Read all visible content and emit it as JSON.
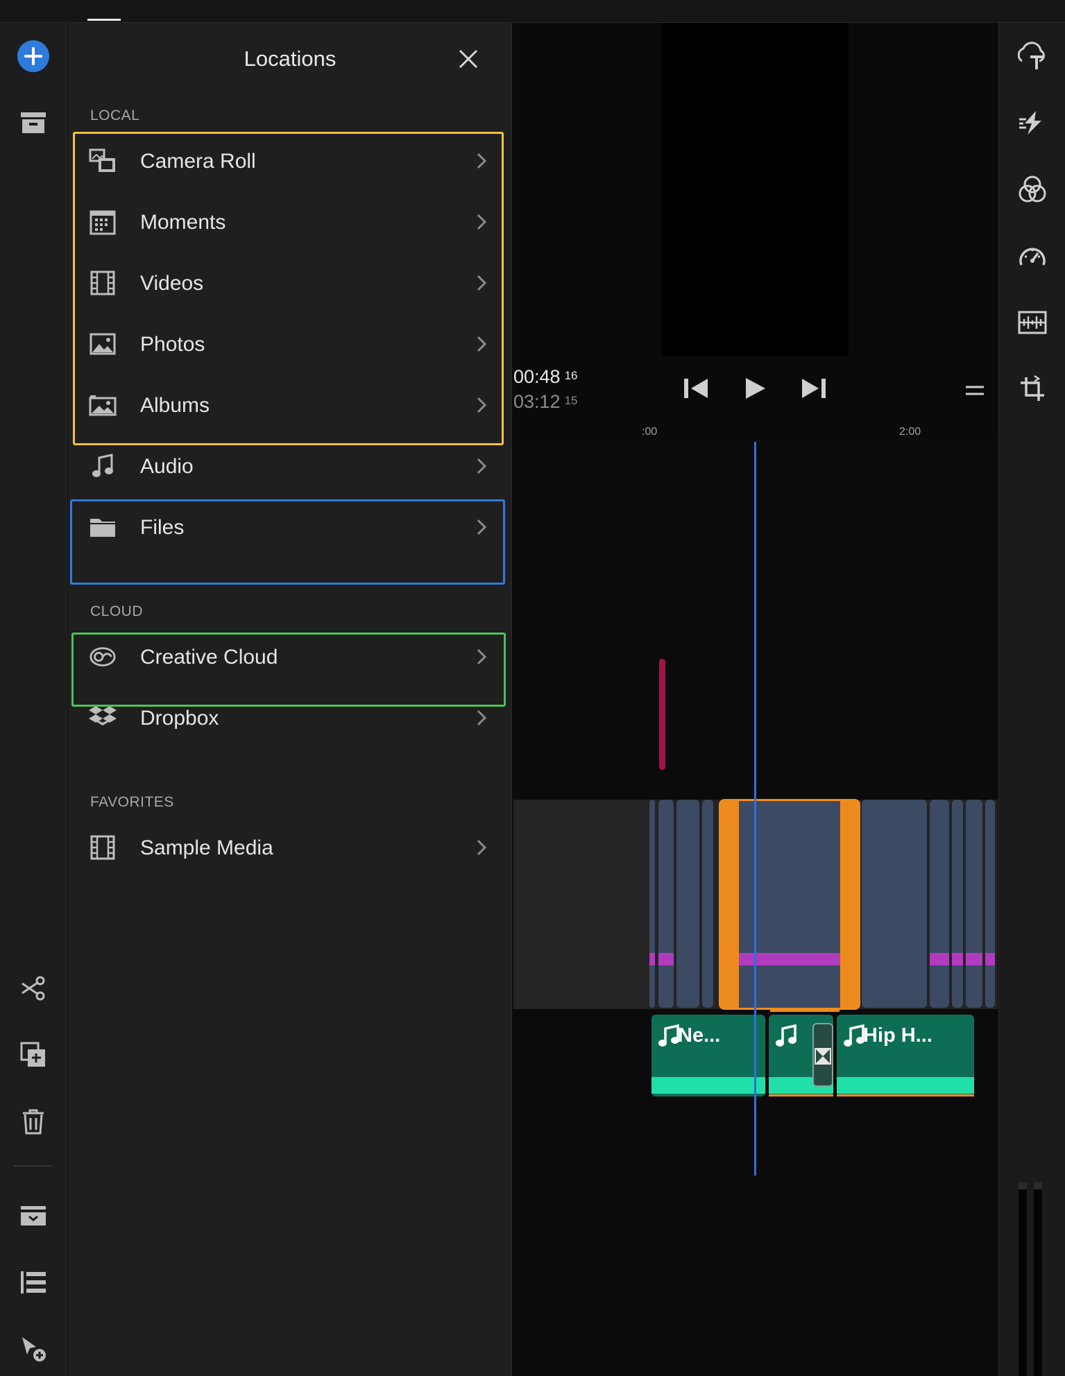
{
  "panel": {
    "title": "Locations",
    "sections": {
      "local": "LOCAL",
      "cloud": "CLOUD",
      "favorites": "FAVORITES"
    },
    "local_items": [
      {
        "label": "Camera Roll",
        "icon": "camera-roll-icon"
      },
      {
        "label": "Moments",
        "icon": "calendar-icon"
      },
      {
        "label": "Videos",
        "icon": "film-icon"
      },
      {
        "label": "Photos",
        "icon": "photo-icon"
      },
      {
        "label": "Albums",
        "icon": "albums-icon"
      },
      {
        "label": "Audio",
        "icon": "music-note-icon"
      },
      {
        "label": "Files",
        "icon": "folder-icon"
      }
    ],
    "cloud_items": [
      {
        "label": "Creative Cloud",
        "icon": "creative-cloud-icon"
      },
      {
        "label": "Dropbox",
        "icon": "dropbox-icon"
      }
    ],
    "favorite_items": [
      {
        "label": "Sample Media",
        "icon": "film-icon"
      }
    ]
  },
  "player": {
    "current_time": "00:48",
    "current_frames": "16",
    "duration": "03:12",
    "duration_frames": "15"
  },
  "timeline": {
    "ruler": [
      ":00",
      "2:00"
    ],
    "audio_clips": [
      {
        "name": "Ne..."
      },
      {
        "name": ""
      },
      {
        "name": "Hip H..."
      }
    ]
  },
  "colors": {
    "accent_blue": "#2f7bdc",
    "highlight_yellow": "#f4c23e",
    "highlight_green": "#49c35a",
    "selection_orange": "#f08c1e",
    "audio_green": "#0e6e55",
    "video_clip": "#3c4a63"
  }
}
